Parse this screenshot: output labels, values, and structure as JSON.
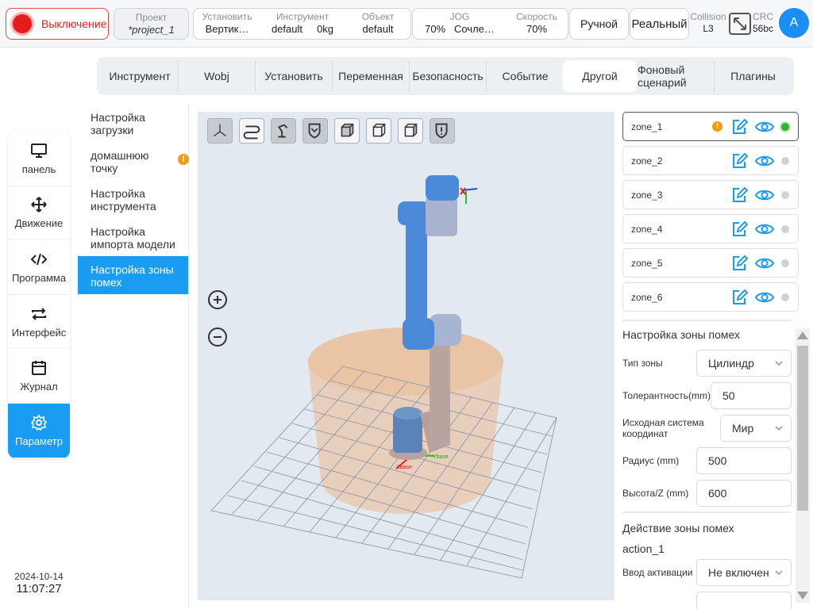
{
  "topbar": {
    "power_label": "Выключение",
    "project": {
      "title": "Проект",
      "value": "*project_1"
    },
    "setup": {
      "title": "Установить",
      "value": "Вертик…"
    },
    "tool": {
      "title": "Инструмент",
      "value": "default",
      "load": "0kg"
    },
    "object": {
      "title": "Объект",
      "value": "default"
    },
    "jog": {
      "title": "JOG",
      "percent": "70%",
      "mode": "Сочле…"
    },
    "speed": {
      "title": "Скорость",
      "value": "70%"
    },
    "manual_label": "Ручной",
    "real_label": "Реальный",
    "collision": {
      "title": "Collision",
      "value": "L3"
    },
    "crc": {
      "title": "CRC",
      "value": "56bc"
    },
    "avatar_letter": "A"
  },
  "leftnav": {
    "items": [
      {
        "label": "панель",
        "icon": "monitor-icon"
      },
      {
        "label": "Движение",
        "icon": "move-arrows-icon"
      },
      {
        "label": "Программа",
        "icon": "code-icon"
      },
      {
        "label": "Интерфейс",
        "icon": "exchange-icon"
      },
      {
        "label": "Журнал",
        "icon": "calendar-icon"
      },
      {
        "label": "Параметр",
        "icon": "gear-icon",
        "active": true
      }
    ]
  },
  "datetime": {
    "date": "2024-10-14",
    "time": "11:07:27"
  },
  "tabs": [
    {
      "label": "Инструмент"
    },
    {
      "label": "Wobj"
    },
    {
      "label": "Установить"
    },
    {
      "label": "Переменная"
    },
    {
      "label": "Безопасность"
    },
    {
      "label": "Событие"
    },
    {
      "label": "Другой",
      "active": true
    },
    {
      "label": "Фоновый сценарий"
    },
    {
      "label": "Плагины"
    }
  ],
  "submenu": [
    {
      "label": "Настройка загрузки"
    },
    {
      "label": "домашнюю точку",
      "warning": "!"
    },
    {
      "label": "Настройка инструмента"
    },
    {
      "label": "Настройка импорта модели"
    },
    {
      "label": "Настройка зоны помех",
      "active": true
    }
  ],
  "viewport": {
    "toolbar_icons": [
      "axes-view-icon",
      "path-icon",
      "robot-arm-icon",
      "shield-badge-icon",
      "cube-front-icon",
      "cube-top-icon",
      "cube-side-icon",
      "shield-alert-icon"
    ],
    "axis_x_label": "Xbase",
    "axis_y_label": "Ybase"
  },
  "zones": [
    {
      "name": "zone_1",
      "warning": "!",
      "active": true
    },
    {
      "name": "zone_2"
    },
    {
      "name": "zone_3"
    },
    {
      "name": "zone_4"
    },
    {
      "name": "zone_5"
    },
    {
      "name": "zone_6"
    }
  ],
  "zone_settings": {
    "title": "Настройка зоны помех",
    "type_label": "Тип зоны",
    "type_value": "Цилиндр",
    "tolerance_label": "Толерантность(mm)",
    "tolerance_value": "50",
    "coord_label": "Исходная система координат",
    "coord_value": "Мир",
    "radius_label": "Радиус (mm)",
    "radius_value": "500",
    "height_label": "Высота/Z (mm)",
    "height_value": "600"
  },
  "zone_action": {
    "title": "Действие зоны помех",
    "action_name": "action_1",
    "activation_label": "Ввод активации",
    "activation_value": "Не включен"
  },
  "colors": {
    "accent": "#1a9cf2",
    "danger": "#e41c1c",
    "warning": "#f39a12",
    "ok": "#2fb52f",
    "robot_blue": "#3b82d6",
    "zone_orange": "#f0a868"
  }
}
